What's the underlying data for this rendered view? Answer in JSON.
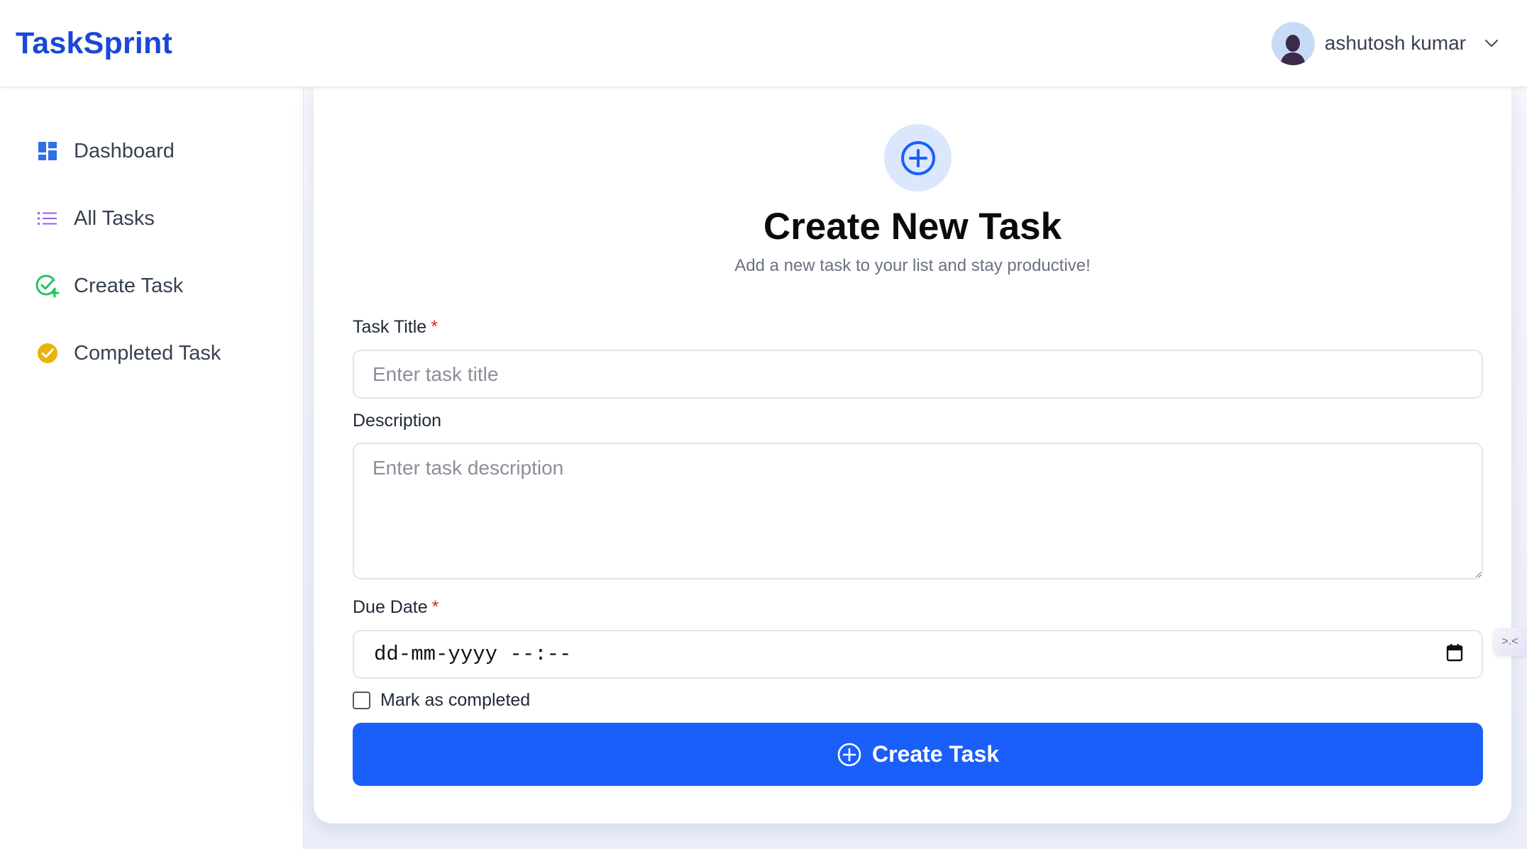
{
  "header": {
    "brand": "TaskSprint",
    "user_name": "ashutosh kumar"
  },
  "sidebar": {
    "items": [
      {
        "label": "Dashboard",
        "icon": "dashboard-icon",
        "color": "#2f6fe8"
      },
      {
        "label": "All Tasks",
        "icon": "list-icon",
        "color": "#9b5de5"
      },
      {
        "label": "Create Task",
        "icon": "check-plus-icon",
        "color": "#22c55e"
      },
      {
        "label": "Completed Task",
        "icon": "check-circle-icon",
        "color": "#eab308"
      }
    ]
  },
  "form": {
    "title": "Create New Task",
    "subtitle": "Add a new task to your list and stay productive!",
    "task_title_label": "Task Title",
    "task_title_placeholder": "Enter task title",
    "description_label": "Description",
    "description_placeholder": "Enter task description",
    "due_date_label": "Due Date",
    "due_date_value": "dd-mm-yyyy --:--",
    "required_mark": "*",
    "completed_label": "Mark as completed",
    "submit_label": "Create Task"
  },
  "colors": {
    "brand": "#1a47d8",
    "primary": "#1a5ffa",
    "required": "#dc2626"
  }
}
